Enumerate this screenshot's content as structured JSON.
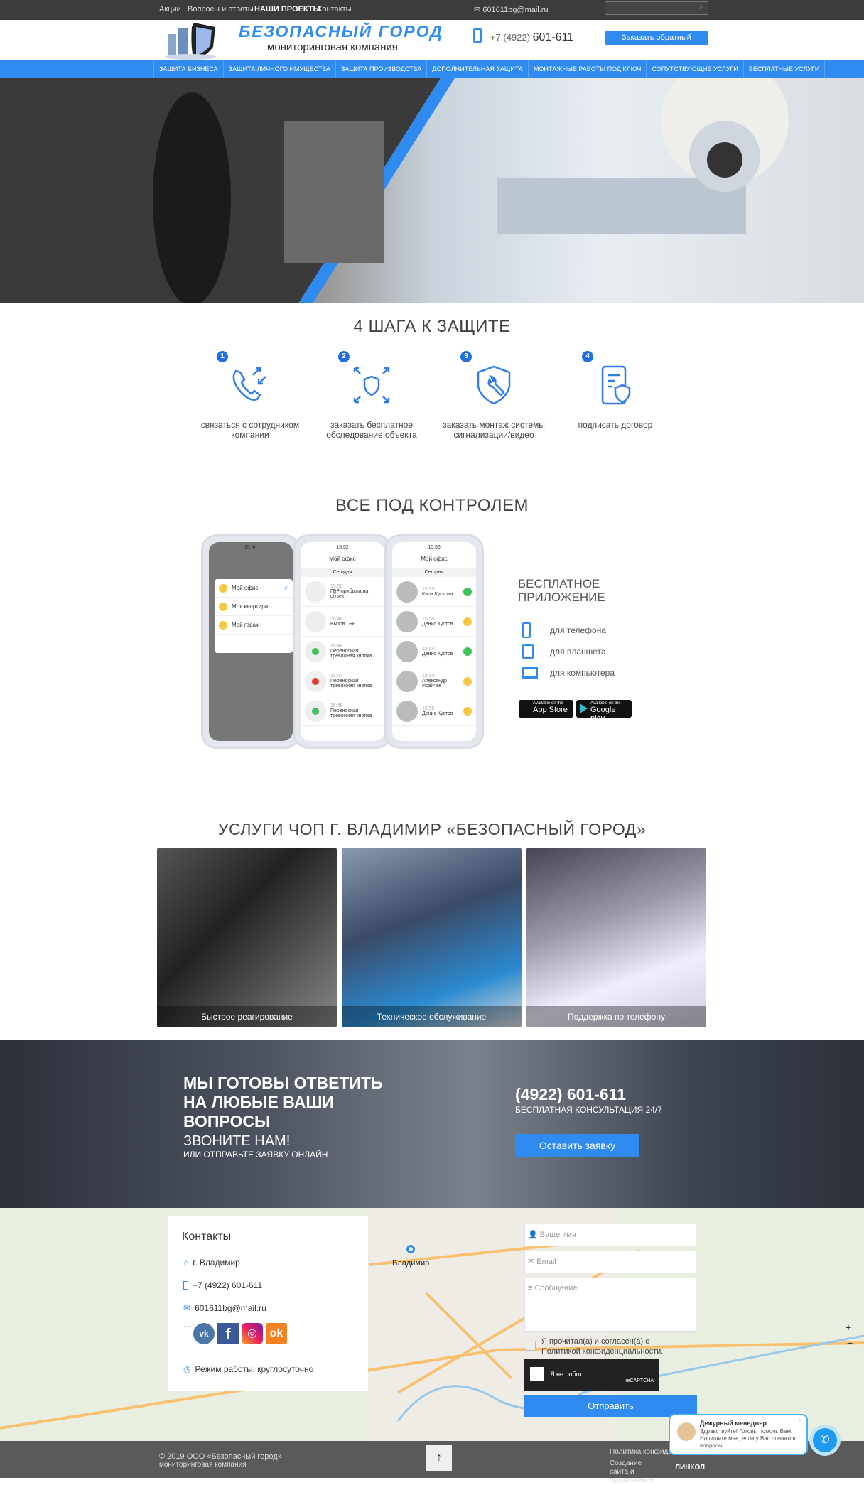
{
  "topbar": {
    "links": [
      "Акции",
      "Вопросы и ответы",
      "НАШИ ПРОЕКТЫ",
      "Контакты"
    ],
    "email": "601611bg@mail.ru",
    "search_placeholder": ""
  },
  "header": {
    "logo_title": "БЕЗОПАСНЫЙ ГОРОД",
    "logo_subtitle": "мониторинговая компания",
    "phone_prefix": "+7 (4922)",
    "phone_number": "601-611",
    "callback_button": "Заказать обратный"
  },
  "nav": {
    "items": [
      "ЗАЩИТА БИЗНЕСА",
      "ЗАЩИТА ЛИЧНОГО ИМУЩЕСТВА",
      "ЗАЩИТА ПРОИЗВОДСТВА",
      "ДОПОЛНИТЕЛЬНАЯ ЗАЩИТА",
      "МОНТАЖНЫЕ РАБОТЫ ПОД КЛЮЧ",
      "СОПУТСТВУЮЩИЕ УСЛУГИ",
      "БЕСПЛАТНЫЕ УСЛУГИ"
    ]
  },
  "steps": {
    "title": "4 ШАГА К ЗАЩИТЕ",
    "items": [
      {
        "n": "1",
        "text": "связаться с сотрудником компании",
        "icon": "phone-call-icon"
      },
      {
        "n": "2",
        "text": "заказать бесплатное обследование объекта",
        "icon": "shield-scan-icon"
      },
      {
        "n": "3",
        "text": "заказать монтаж системы сигнализации/видео",
        "icon": "shield-wrench-icon"
      },
      {
        "n": "4",
        "text": "подписать договор",
        "icon": "document-shield-icon"
      }
    ]
  },
  "app": {
    "title": "ВСЕ ПОД КОНТРОЛЕМ",
    "subtitle": "БЕСПЛАТНОЕ ПРИЛОЖЕНИЕ",
    "platforms": [
      "для телефона",
      "для планшета",
      "для компьютера"
    ],
    "appstore_small": "Available on the",
    "appstore": "App Store",
    "googleplay_small": "Available on the",
    "googleplay": "Google play",
    "phone1": {
      "time": "15:44",
      "menu": [
        "Мой офис",
        "Моя квартира",
        "Мой гараж"
      ]
    },
    "phone2": {
      "time": "15:52",
      "header": "Мой офис",
      "day": "Сегодня",
      "events": [
        {
          "time": "15:50",
          "text": "ГБР прибыла на объект"
        },
        {
          "time": "15:48",
          "text": "Вызов ГБР"
        },
        {
          "time": "15:48",
          "text": "Переносная тревожная кнопка"
        },
        {
          "time": "15:47",
          "text": "Переносная тревожная кнопка"
        },
        {
          "time": "15:46",
          "text": "Переносная тревожная кнопка"
        }
      ]
    },
    "phone3": {
      "time": "15:56",
      "header": "Мой офис",
      "day": "Сегодня",
      "events": [
        {
          "time": "15:55",
          "text": "Кира Кустова",
          "lock": "#3cc45a"
        },
        {
          "time": "15:55",
          "text": "Денис Кустов",
          "lock": "#f5c842"
        },
        {
          "time": "15:54",
          "text": "Денис Кустов",
          "lock": "#3cc45a"
        },
        {
          "time": "15:54",
          "text": "Александр Исайчев",
          "lock": "#f5c842"
        },
        {
          "time": "15:55",
          "text": "Денис Кустов",
          "lock": "#f5c842"
        }
      ]
    }
  },
  "services": {
    "title": "УСЛУГИ ЧОП Г. ВЛАДИМИР «БЕЗОПАСНЫЙ ГОРОД»",
    "cards": [
      "Быстрое реагирование",
      "Техническое обслуживание",
      "Поддержка по телефону"
    ]
  },
  "cta": {
    "line1": "МЫ ГОТОВЫ ОТВЕТИТЬ",
    "line2": "НА ЛЮБЫЕ ВАШИ",
    "line3": "ВОПРОСЫ",
    "call": "ЗВОНИТЕ НАМ!",
    "or": "ИЛИ ОТПРАВЬТЕ ЗАЯВКУ ОНЛАЙН",
    "phone": "(4922) 601-611",
    "consult": "БЕСПЛАТНАЯ КОНСУЛЬТАЦИЯ 24/7",
    "button": "Оставить заявку"
  },
  "contacts": {
    "title": "Контакты",
    "city": "г. Владимир",
    "phone": "+7 (4922) 601-611",
    "email": "601611bg@mail.ru",
    "hours": "Режим работы: круглосуточно",
    "map_city": "Владимир"
  },
  "form": {
    "name_placeholder": "Ваше имя",
    "email_placeholder": "Email",
    "message_placeholder": "Сообщение",
    "agree": "Я прочитал(а) и согласен(а) с Политикой конфиденциальности.",
    "captcha": "Я не робот",
    "recaptcha": "reCAPTCHA",
    "submit": "Отправить"
  },
  "chat": {
    "name": "Дежурный менеджер",
    "message": "Здравствуйте! Готовы помочь Вам. Напишите мне, если у Вас появятся вопросы."
  },
  "footer": {
    "copyright": "© 2019 ООО «Безопасный город»",
    "subtitle": "мониторинговая компания",
    "policy": "Политика конфиденциальности",
    "creator": "Создание сайта и продвижение",
    "creator_logo": "ЛИНКОЛ",
    "up": "↑"
  },
  "colors": {
    "accent": "#2f8bf0",
    "dark": "#3c3c3c"
  }
}
